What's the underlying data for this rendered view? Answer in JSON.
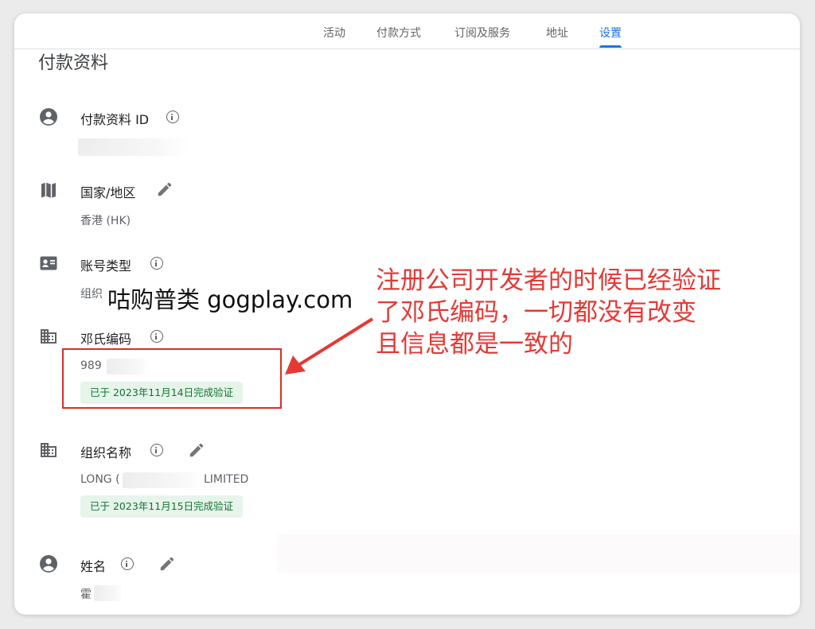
{
  "tabs": [
    {
      "label": "活动",
      "active": false
    },
    {
      "label": "付款方式",
      "active": false
    },
    {
      "label": "订阅及服务",
      "active": false
    },
    {
      "label": "地址",
      "active": false
    },
    {
      "label": "设置",
      "active": true
    }
  ],
  "page_title": "付款资料",
  "fields": {
    "profile_id": {
      "label": "付款资料 ID",
      "icon": "account-circle-icon"
    },
    "country": {
      "label": "国家/地区",
      "value": "香港 (HK)",
      "icon": "map-icon"
    },
    "account_type": {
      "label": "账号类型",
      "value_partial": "组织",
      "icon": "contact-card-icon"
    },
    "duns": {
      "label": "邓氏编码",
      "value_partial": "989",
      "badge": "已于 2023年11月14日完成验证",
      "icon": "building-icon"
    },
    "org_name": {
      "label": "组织名称",
      "value_prefix": "LONG (",
      "value_suffix": "LIMITED",
      "badge": "已于 2023年11月15日完成验证",
      "icon": "building-icon"
    },
    "name": {
      "label": "姓名",
      "value_partial": "霍",
      "icon": "account-circle-icon"
    }
  },
  "watermark": "咕购普类 gogplay.com",
  "annotation": {
    "lines": [
      "注册公司开发者的时候已经验证",
      "了邓氏编码，一切都没有改变",
      "且信息都是一致的"
    ],
    "color": "#e53935"
  },
  "colors": {
    "accent": "#1a73e8",
    "badge_bg": "#e6f4ea",
    "badge_text": "#137333",
    "highlight": "#d93025"
  }
}
